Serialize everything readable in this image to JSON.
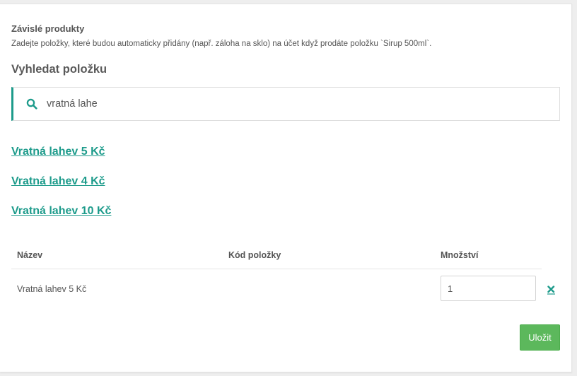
{
  "dependent_products": {
    "title": "Závislé produkty",
    "description": "Zadejte položky, které budou automaticky přidány (např. záloha na sklo) na účet když prodáte položku `Sirup 500ml`."
  },
  "search": {
    "label": "Vyhledat položku",
    "value": "vratná lahe",
    "icon": "search-icon"
  },
  "results": [
    {
      "label": "Vratná lahev 5 Kč"
    },
    {
      "label": "Vratná lahev 4 Kč"
    },
    {
      "label": "Vratná lahev 10 Kč"
    }
  ],
  "table": {
    "headers": {
      "name": "Název",
      "code": "Kód položky",
      "quantity": "Množství"
    },
    "rows": [
      {
        "name": "Vratná lahev 5 Kč",
        "code": "",
        "quantity": "1",
        "remove_icon": "close-icon"
      }
    ]
  },
  "save_label": "Uložit",
  "colors": {
    "accent": "#1d9b8b",
    "save": "#5cb85c",
    "text": "#555555",
    "background": "#eeeeee"
  }
}
